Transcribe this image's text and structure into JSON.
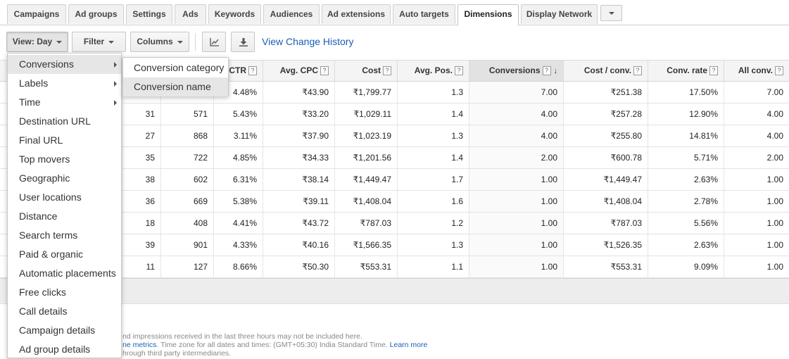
{
  "tabs": [
    {
      "label": "Campaigns",
      "active": false
    },
    {
      "label": "Ad groups",
      "active": false
    },
    {
      "label": "Settings",
      "active": false
    },
    {
      "label": "Ads",
      "active": false
    },
    {
      "label": "Keywords",
      "active": false
    },
    {
      "label": "Audiences",
      "active": false
    },
    {
      "label": "Ad extensions",
      "active": false
    },
    {
      "label": "Auto targets",
      "active": false
    },
    {
      "label": "Dimensions",
      "active": true
    },
    {
      "label": "Display Network",
      "active": false
    }
  ],
  "toolbar": {
    "view_label": "View: Day",
    "filter_label": "Filter",
    "columns_label": "Columns",
    "chart_icon": "line-chart-icon",
    "download_icon": "download-icon",
    "history_link": "View Change History"
  },
  "table": {
    "columns": [
      {
        "label": "",
        "help": false
      },
      {
        "label": "",
        "help": false
      },
      {
        "label": "CTR",
        "help": true
      },
      {
        "label": "Avg. CPC",
        "help": true
      },
      {
        "label": "Cost",
        "help": true
      },
      {
        "label": "Avg. Pos.",
        "help": true
      },
      {
        "label": "Conversions",
        "help": true,
        "sorted": true,
        "sort_icon": "sort-down-arrow-icon"
      },
      {
        "label": "Cost / conv.",
        "help": true
      },
      {
        "label": "Conv. rate",
        "help": true
      },
      {
        "label": "All conv.",
        "help": true
      }
    ],
    "help_glyph": "?",
    "sort_glyph": "↓",
    "rows": [
      [
        "",
        "",
        "4.48%",
        "₹43.90",
        "₹1,799.77",
        "1.3",
        "7.00",
        "₹251.38",
        "17.50%",
        "7.00"
      ],
      [
        "31",
        "571",
        "5.43%",
        "₹33.20",
        "₹1,029.11",
        "1.4",
        "4.00",
        "₹257.28",
        "12.90%",
        "4.00"
      ],
      [
        "27",
        "868",
        "3.11%",
        "₹37.90",
        "₹1,023.19",
        "1.3",
        "4.00",
        "₹255.80",
        "14.81%",
        "4.00"
      ],
      [
        "35",
        "722",
        "4.85%",
        "₹34.33",
        "₹1,201.56",
        "1.4",
        "2.00",
        "₹600.78",
        "5.71%",
        "2.00"
      ],
      [
        "38",
        "602",
        "6.31%",
        "₹38.14",
        "₹1,449.47",
        "1.7",
        "1.00",
        "₹1,449.47",
        "2.63%",
        "1.00"
      ],
      [
        "36",
        "669",
        "5.38%",
        "₹39.11",
        "₹1,408.04",
        "1.6",
        "1.00",
        "₹1,408.04",
        "2.78%",
        "1.00"
      ],
      [
        "18",
        "408",
        "4.41%",
        "₹43.72",
        "₹787.03",
        "1.2",
        "1.00",
        "₹787.03",
        "5.56%",
        "1.00"
      ],
      [
        "39",
        "901",
        "4.33%",
        "₹40.16",
        "₹1,566.35",
        "1.3",
        "1.00",
        "₹1,526.35",
        "2.63%",
        "1.00"
      ],
      [
        "11",
        "127",
        "8.66%",
        "₹50.30",
        "₹553.31",
        "1.1",
        "1.00",
        "₹553.31",
        "9.09%",
        "1.00"
      ]
    ]
  },
  "footnotes": {
    "line1": "nd impressions received in the last three hours may not be included here.",
    "line2_link": "ne metrics",
    "line2_text": ". Time zone for all dates and times: (GMT+05:30) India Standard Time.",
    "line2_learn": "Learn more",
    "line3": "hrough third party intermediaries."
  },
  "view_menu": {
    "items": [
      {
        "label": "Conversions",
        "submenu": true,
        "hover": true
      },
      {
        "label": "Labels",
        "submenu": true
      },
      {
        "label": "Time",
        "submenu": true
      },
      {
        "label": "Destination URL"
      },
      {
        "label": "Final URL"
      },
      {
        "label": "Top movers"
      },
      {
        "label": "Geographic"
      },
      {
        "label": "User locations"
      },
      {
        "label": "Distance"
      },
      {
        "label": "Search terms"
      },
      {
        "label": "Paid & organic"
      },
      {
        "label": "Automatic placements"
      },
      {
        "label": "Free clicks"
      },
      {
        "label": "Call details"
      },
      {
        "label": "Campaign details"
      },
      {
        "label": "Ad group details"
      }
    ],
    "submenu_items": [
      {
        "label": "Conversion category"
      },
      {
        "label": "Conversion name",
        "hover": true
      }
    ]
  }
}
